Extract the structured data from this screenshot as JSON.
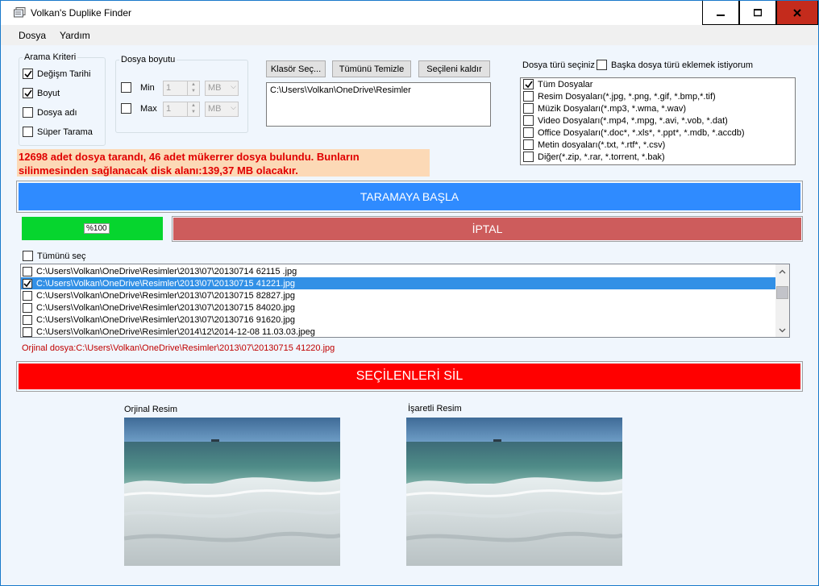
{
  "window": {
    "title": "Volkan's Duplike Finder"
  },
  "menu": {
    "items": [
      "Dosya",
      "Yardım"
    ]
  },
  "criteria": {
    "title": "Arama Kriteri",
    "options": [
      {
        "label": "Değişm Tarihi",
        "checked": true
      },
      {
        "label": "Boyut",
        "checked": true
      },
      {
        "label": "Dosya adı",
        "checked": false
      },
      {
        "label": "Süper Tarama",
        "checked": false
      }
    ]
  },
  "size": {
    "title": "Dosya boyutu",
    "min_label": "Min",
    "min_value": "1",
    "min_unit": "MB",
    "max_label": "Max",
    "max_value": "1",
    "max_unit": "MB"
  },
  "folders": {
    "select_button": "Klasör Seç...",
    "clear_button": "Tümünü Temizle",
    "remove_button": "Seçileni kaldır",
    "paths": [
      "C:\\Users\\Volkan\\OneDrive\\Resimler"
    ]
  },
  "filetypes": {
    "title": "Dosya türü seçiniz",
    "extra_label": "Başka dosya türü eklemek istiyorum",
    "extra_checked": false,
    "items": [
      {
        "label": "Tüm Dosyalar",
        "checked": true
      },
      {
        "label": "Resim Dosyaları(*.jpg, *.png, *.gif, *.bmp,*.tif)",
        "checked": false
      },
      {
        "label": "Müzik Dosyaları(*.mp3, *.wma, *.wav)",
        "checked": false
      },
      {
        "label": "Video Dosyaları(*.mp4, *.mpg, *.avi, *.vob, *.dat)",
        "checked": false
      },
      {
        "label": "Office Dosyaları(*.doc*, *.xls*, *.ppt*, *.mdb, *.accdb)",
        "checked": false
      },
      {
        "label": "Metin dosyaları(*.txt, *.rtf*, *.csv)",
        "checked": false
      },
      {
        "label": "Diğer(*.zip, *.rar, *.torrent, *.bak)",
        "checked": false
      }
    ]
  },
  "status": {
    "line1": "12698 adet dosya tarandı, 46 adet mükerrer dosya bulundu. Bunların",
    "line2": "silinmesinden sağlanacak disk alanı:139,37 MB olacakır."
  },
  "actions": {
    "scan_button": "TARAMAYA BAŞLA",
    "cancel_button": "İPTAL",
    "delete_button": "SEÇİLENLERİ SİL"
  },
  "progress": {
    "label": "%100",
    "value": 1.0
  },
  "results": {
    "select_all_label": "Tümünü seç",
    "rows": [
      {
        "path": "C:\\Users\\Volkan\\OneDrive\\Resimler\\2013\\07\\20130714 62115 .jpg",
        "checked": false,
        "selected": false
      },
      {
        "path": "C:\\Users\\Volkan\\OneDrive\\Resimler\\2013\\07\\20130715 41221.jpg",
        "checked": true,
        "selected": true
      },
      {
        "path": "C:\\Users\\Volkan\\OneDrive\\Resimler\\2013\\07\\20130715 82827.jpg",
        "checked": false,
        "selected": false
      },
      {
        "path": "C:\\Users\\Volkan\\OneDrive\\Resimler\\2013\\07\\20130715 84020.jpg",
        "checked": false,
        "selected": false
      },
      {
        "path": "C:\\Users\\Volkan\\OneDrive\\Resimler\\2013\\07\\20130716 91620.jpg",
        "checked": false,
        "selected": false
      },
      {
        "path": "C:\\Users\\Volkan\\OneDrive\\Resimler\\2014\\12\\2014-12-08 11.03.03.jpeg",
        "checked": false,
        "selected": false
      }
    ],
    "original_path": "Orjinal dosya:C:\\Users\\Volkan\\OneDrive\\Resimler\\2013\\07\\20130715 41220.jpg"
  },
  "preview": {
    "original_caption": "Orjinal Resim",
    "marked_caption": "İşaretli Resim"
  },
  "colors": {
    "scan": "#2f8bff",
    "progress": "#06d52e",
    "cancel": "#cd5c5c",
    "delete": "#ff0000"
  }
}
